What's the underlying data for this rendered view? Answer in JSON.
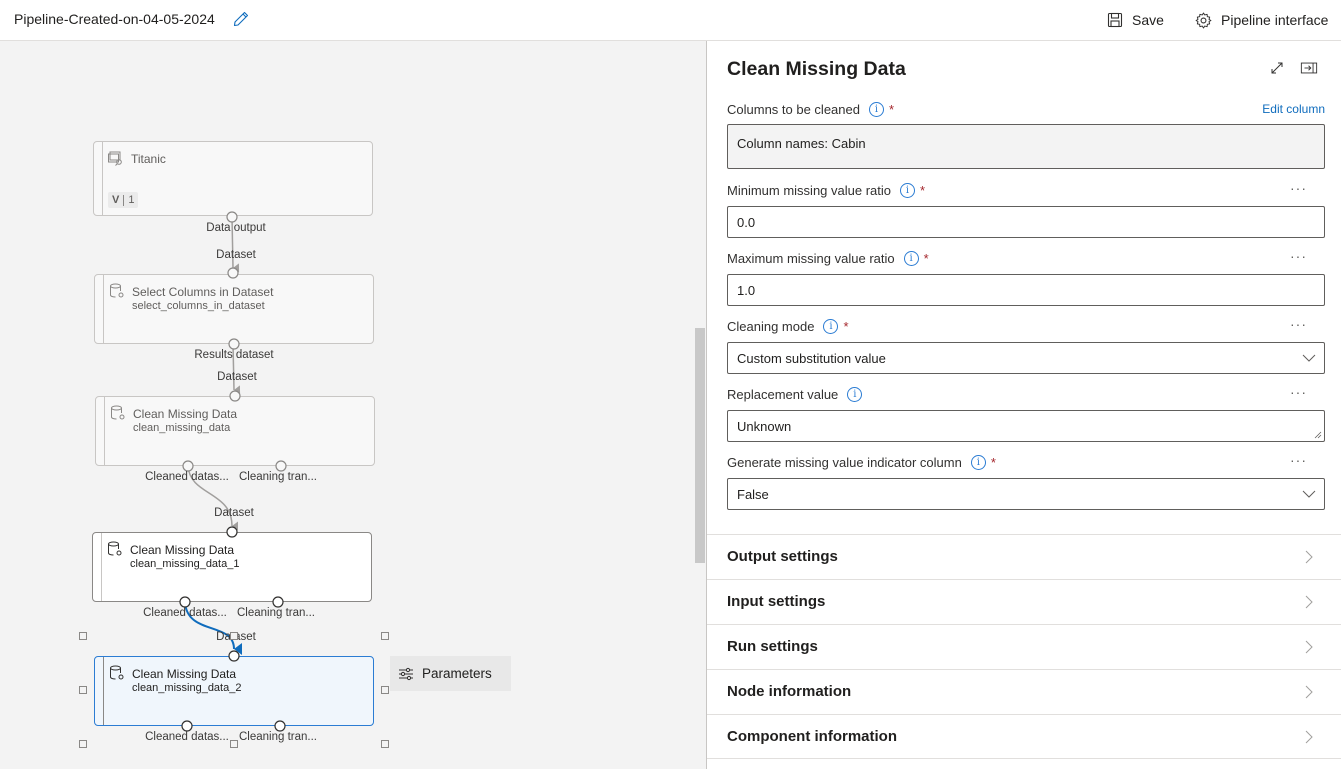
{
  "topbar": {
    "title": "Pipeline-Created-on-04-05-2024",
    "save_label": "Save",
    "interface_label": "Pipeline interface"
  },
  "canvas": {
    "nodes": [
      {
        "title": "Titanic",
        "subtitle": "",
        "version_label": "V",
        "version": "1",
        "state": "inactive"
      },
      {
        "title": "Select Columns in Dataset",
        "subtitle": "select_columns_in_dataset",
        "state": "inactive"
      },
      {
        "title": "Clean Missing Data",
        "subtitle": "clean_missing_data",
        "state": "inactive"
      },
      {
        "title": "Clean Missing Data",
        "subtitle": "clean_missing_data_1",
        "state": "active"
      },
      {
        "title": "Clean Missing Data",
        "subtitle": "clean_missing_data_2",
        "state": "selected"
      }
    ],
    "port_labels": {
      "titanic_out": "Data output",
      "select_in": "Dataset",
      "select_out": "Results dataset",
      "clean0_in": "Dataset",
      "clean0_out1": "Cleaned datas...",
      "clean0_out2": "Cleaning tran...",
      "clean1_in": "Dataset",
      "clean1_out1": "Cleaned datas...",
      "clean1_out2": "Cleaning tran...",
      "clean2_in": "Dataset",
      "clean2_out1": "Cleaned datas...",
      "clean2_out2": "Cleaning tran..."
    },
    "parameters_label": "Parameters",
    "colors": {
      "edge": "#a19f9d",
      "selected_edge": "#0f6cbd",
      "selected_border": "#2b7cd3"
    }
  },
  "panel": {
    "title": "Clean Missing Data",
    "edit_column_label": "Edit column",
    "fields": [
      {
        "label": "Columns to be cleaned",
        "required": true,
        "value": "Column names: Cabin",
        "type": "readonly"
      },
      {
        "label": "Minimum missing value ratio",
        "required": true,
        "value": "0.0",
        "type": "text"
      },
      {
        "label": "Maximum missing value ratio",
        "required": true,
        "value": "1.0",
        "type": "text"
      },
      {
        "label": "Cleaning mode",
        "required": true,
        "value": "Custom substitution value",
        "type": "dropdown"
      },
      {
        "label": "Replacement value",
        "required": false,
        "value": "Unknown",
        "type": "textarea"
      },
      {
        "label": "Generate missing value indicator column",
        "required": true,
        "value": "False",
        "type": "dropdown"
      }
    ],
    "required_marker": "*",
    "info_glyph": "i",
    "more_glyph": "···",
    "sections": [
      {
        "label": "Output settings"
      },
      {
        "label": "Input settings"
      },
      {
        "label": "Run settings"
      },
      {
        "label": "Node information"
      },
      {
        "label": "Component information"
      }
    ]
  }
}
